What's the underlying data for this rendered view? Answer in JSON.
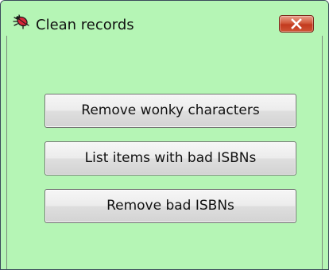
{
  "window": {
    "title": "Clean records",
    "app_icon": "bug-icon",
    "close_icon": "close-icon",
    "colors": {
      "background": "#b5f5b5",
      "close_button": "#c8452a"
    }
  },
  "actions": {
    "remove_wonky_label": "Remove wonky characters",
    "list_bad_isbns_label": "List items with bad ISBNs",
    "remove_bad_isbns_label": "Remove bad ISBNs"
  }
}
